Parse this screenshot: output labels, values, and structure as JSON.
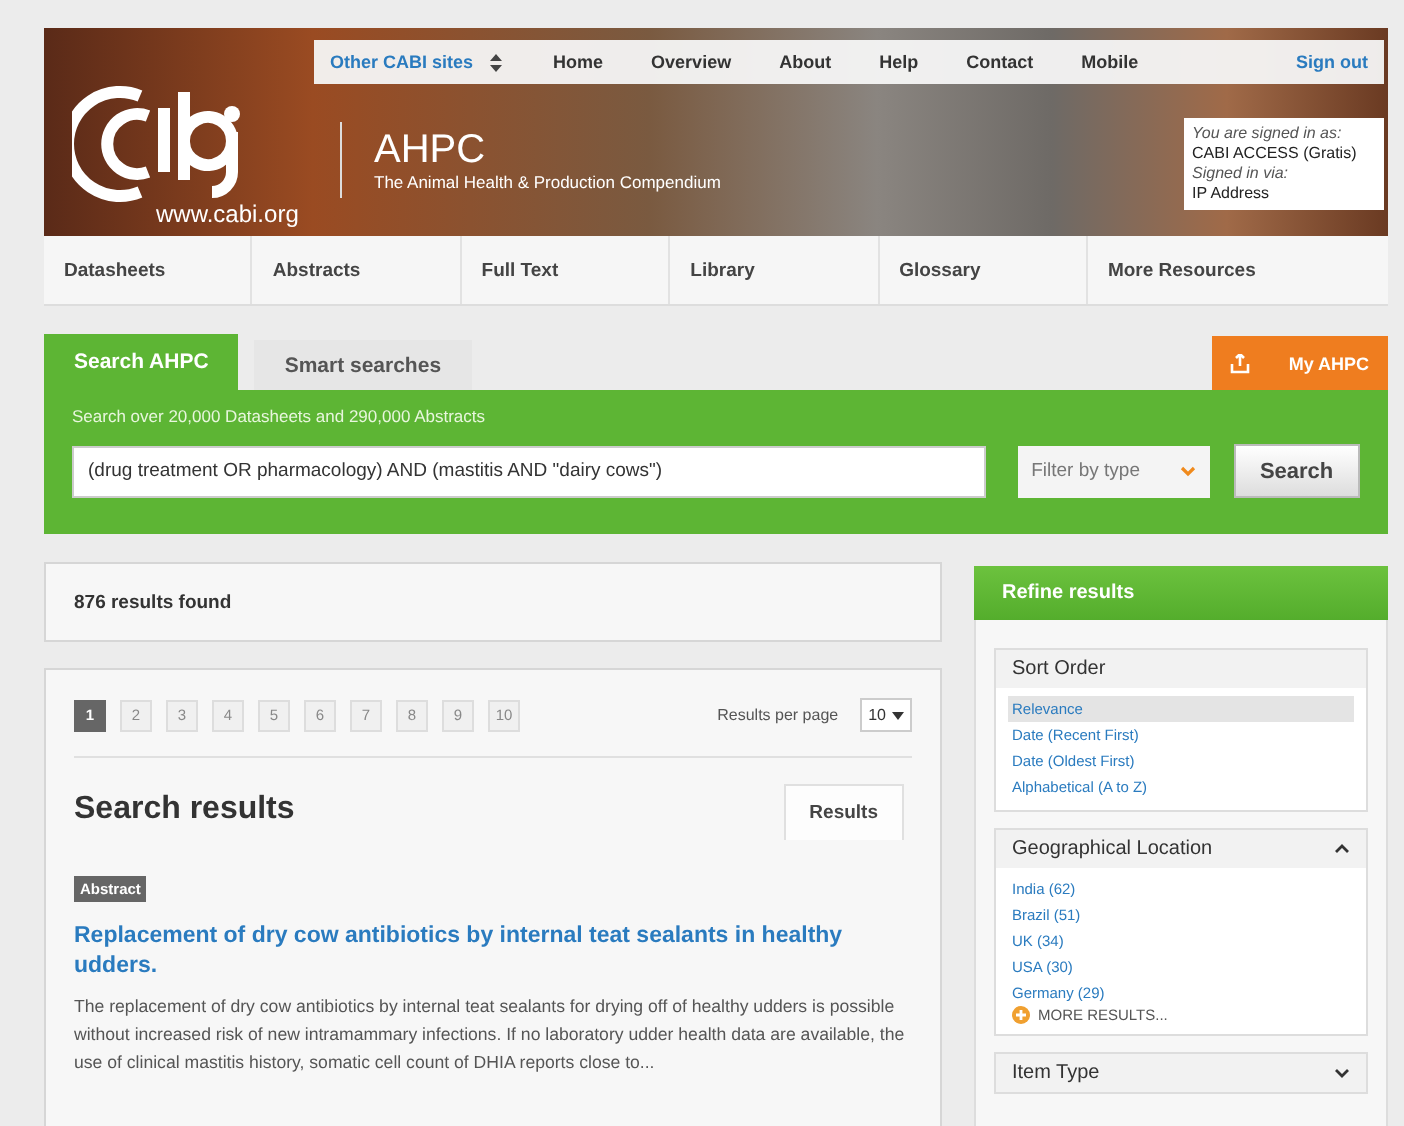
{
  "header": {
    "top_links": [
      {
        "label": "Other CABI sites",
        "kind": "dropdown"
      },
      {
        "label": "Home",
        "kind": "link"
      },
      {
        "label": "Overview",
        "kind": "link"
      },
      {
        "label": "About",
        "kind": "link"
      },
      {
        "label": "Help",
        "kind": "link"
      },
      {
        "label": "Contact",
        "kind": "link"
      },
      {
        "label": "Mobile",
        "kind": "link"
      }
    ],
    "sign_out": "Sign out",
    "site_url": "www.cabi.org",
    "title": "AHPC",
    "subtitle": "The Animal Health & Production Compendium",
    "signin": [
      "You are signed in as:",
      "CABI ACCESS (Gratis)",
      "Signed in via:",
      "IP Address"
    ]
  },
  "nav": [
    "Datasheets",
    "Abstracts",
    "Full Text",
    "Library",
    "Glossary",
    "More Resources"
  ],
  "search": {
    "tabs": [
      {
        "label": "Search AHPC",
        "selected": true
      },
      {
        "label": "Smart searches",
        "selected": false
      }
    ],
    "my_button": "My AHPC",
    "hint": "Search over 20,000 Datasheets and 290,000 Abstracts",
    "value": "(drug treatment OR pharmacology) AND (mastitis AND \"dairy cows\")",
    "filter": "Filter by type",
    "button": "Search"
  },
  "results_count": "876 results found",
  "pagination": {
    "pages": [
      {
        "label": "1",
        "selected": true
      },
      {
        "label": "2",
        "selected": false
      },
      {
        "label": "3",
        "selected": false
      },
      {
        "label": "4",
        "selected": false
      },
      {
        "label": "5",
        "selected": false
      },
      {
        "label": "6",
        "selected": false
      },
      {
        "label": "7",
        "selected": false
      },
      {
        "label": "8",
        "selected": false
      },
      {
        "label": "9",
        "selected": false
      },
      {
        "label": "10",
        "selected": false
      }
    ],
    "per_page_label": "Results per page",
    "per_page": "10"
  },
  "results": {
    "heading": "Search results",
    "tab": "Results",
    "items": [
      {
        "badge": "Abstract",
        "title": "Replacement of dry cow antibiotics by internal teat sealants in healthy udders.",
        "snippet": "The replacement of dry cow antibiotics by internal teat sealants for drying off of healthy udders is possible without increased risk of new intramammary infections. If no laboratory udder health data are available, the use of clinical mastitis history, somatic cell count of DHIA reports close to..."
      }
    ]
  },
  "refine": {
    "title": "Refine results",
    "groups": [
      {
        "kind": "sort",
        "title": "Sort Order",
        "options": [
          {
            "label": "Relevance",
            "selected": true
          },
          {
            "label": "Date (Recent First)",
            "selected": false
          },
          {
            "label": "Date (Oldest First)",
            "selected": false
          },
          {
            "label": "Alphabetical (A to Z)",
            "selected": false
          }
        ]
      },
      {
        "kind": "filter",
        "title": "Geographical Location",
        "expanded": true,
        "options": [
          {
            "label": "India (62)"
          },
          {
            "label": "Brazil (51)"
          },
          {
            "label": "UK (34)"
          },
          {
            "label": "USA (30)"
          },
          {
            "label": "Germany (29)"
          }
        ],
        "more": "MORE RESULTS..."
      },
      {
        "kind": "filter",
        "title": "Item Type",
        "expanded": false
      }
    ]
  }
}
